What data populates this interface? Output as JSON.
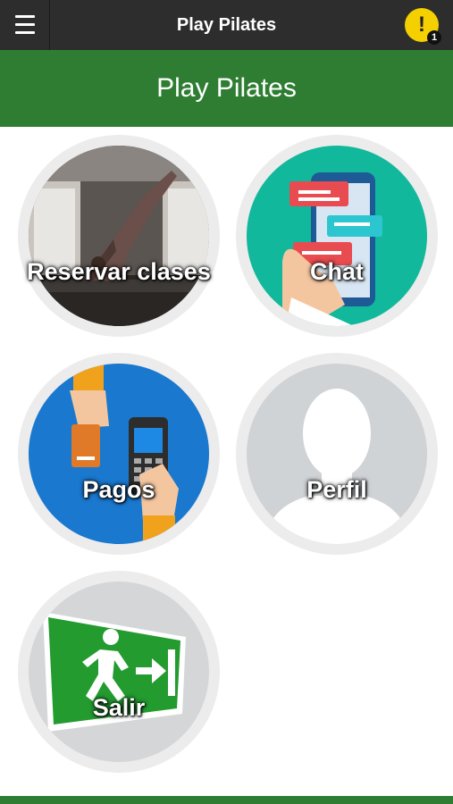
{
  "app": {
    "title": "Play Pilates"
  },
  "header": {
    "title": "Play Pilates"
  },
  "notifications": {
    "icon": "alert-icon",
    "symbol": "!",
    "count": "1"
  },
  "menu": {
    "icon": "hamburger-menu-icon"
  },
  "tiles": [
    {
      "label": "Reservar clases",
      "icon": "pilates-photo"
    },
    {
      "label": "Chat",
      "icon": "chat-phone-icon"
    },
    {
      "label": "Pagos",
      "icon": "payment-terminal-icon"
    },
    {
      "label": "Perfil",
      "icon": "user-silhouette-icon"
    },
    {
      "label": "Salir",
      "icon": "exit-sign-icon"
    }
  ],
  "colors": {
    "topbar": "#2d2d2d",
    "brand_green": "#2e7d32",
    "alert": "#f5d000"
  }
}
